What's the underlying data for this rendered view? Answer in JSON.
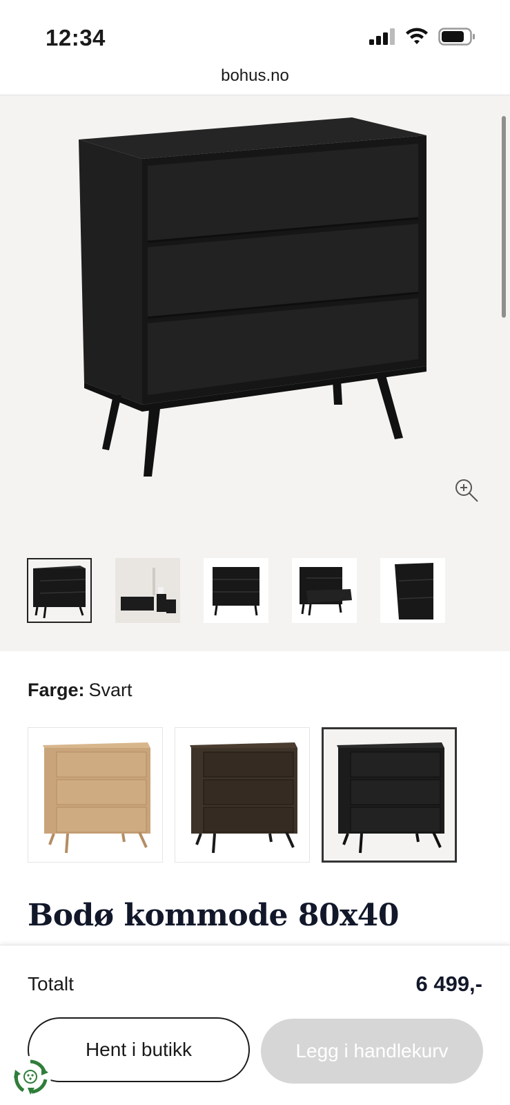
{
  "status_bar": {
    "time": "12:34",
    "icons": [
      "cellular-signal-icon",
      "wifi-icon",
      "battery-icon"
    ]
  },
  "browser": {
    "url": "bohus.no"
  },
  "gallery": {
    "main_image": "black-dresser-image",
    "thumbnails": [
      {
        "name": "front-angle",
        "selected": true
      },
      {
        "name": "room-setting",
        "selected": false
      },
      {
        "name": "front",
        "selected": false
      },
      {
        "name": "drawer-open",
        "selected": false
      },
      {
        "name": "side",
        "selected": false
      }
    ]
  },
  "color": {
    "label": "Farge:",
    "value": "Svart",
    "swatches": [
      {
        "name": "oak",
        "color": "#c9a47a",
        "selected": false
      },
      {
        "name": "dark-brown",
        "color": "#3e3328",
        "selected": false
      },
      {
        "name": "black",
        "color": "#1c1c1c",
        "selected": true
      }
    ]
  },
  "product": {
    "title": "Bodø kommode 80x40"
  },
  "checkout": {
    "total_label": "Totalt",
    "total_value": "6 499,-",
    "store_button": "Hent i butikk",
    "cart_button": "Legg i handlekurv"
  },
  "colors": {
    "gallery_bg": "#f4f3f1",
    "title": "#12182a",
    "disabled_button": "#d6d6d6",
    "eco_green": "#2f7d3a"
  }
}
